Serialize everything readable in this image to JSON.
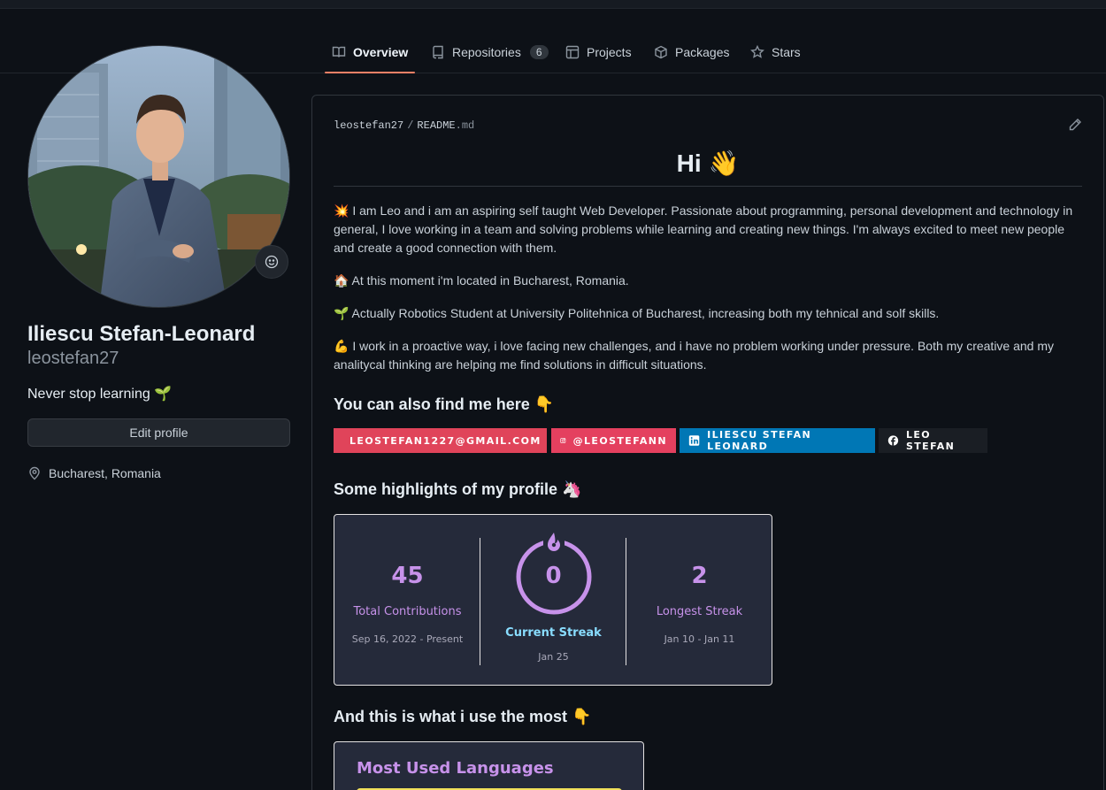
{
  "tabs": [
    {
      "label": "Overview",
      "icon": "book-icon"
    },
    {
      "label": "Repositories",
      "count": "6",
      "icon": "repo-icon"
    },
    {
      "label": "Projects",
      "icon": "table-icon"
    },
    {
      "label": "Packages",
      "icon": "package-icon"
    },
    {
      "label": "Stars",
      "icon": "star-icon"
    }
  ],
  "profile": {
    "fullname": "Iliescu Stefan-Leonard",
    "login": "leostefan27",
    "bio": "Never stop learning 🌱",
    "edit_label": "Edit profile",
    "location": "Bucharest, Romania"
  },
  "readme": {
    "owner": "leostefan27",
    "sep": "/",
    "file": "README",
    "ext": ".md",
    "heading": "Hi 👋",
    "paragraphs": [
      "💥 I am Leo and i am an aspiring self taught Web Developer. Passionate about programming, personal development and technology in general, I love working in a team and solving problems while learning and creating new things. I'm always excited to meet new people and create a good connection with them.",
      "🏠 At this moment i'm located in Bucharest, Romania.",
      "🌱 Actually Robotics Student at University Politehnica of Bucharest, increasing both my tehnical and solf skills.",
      "💪 I work in a proactive way, i love facing new challenges, and i have no problem working under pressure. Both my creative and my analitycal thinking are helping me find solutions in difficult situations."
    ],
    "find_me_heading": "You can also find me here 👇",
    "badges": [
      {
        "label": "LEOSTEFAN1227@GMAIL.COM",
        "color": "#d14836",
        "icon": "gmail-icon"
      },
      {
        "label": "@LEOSTEFANN",
        "color": "#e4405f",
        "icon": "instagram-icon"
      },
      {
        "label": "ILIESCU STEFAN LEONARD",
        "color": "#0077b5",
        "icon": "linkedin-icon"
      },
      {
        "label": "LEO STEFAN",
        "color": "#1a1e24",
        "icon": "facebook-icon"
      }
    ],
    "highlights_heading": "Some highlights of my profile 🦄",
    "streak": {
      "total": {
        "value": "45",
        "label": "Total Contributions",
        "range": "Sep 16, 2022 - Present"
      },
      "current": {
        "value": "0",
        "label": "Current Streak",
        "range": "Jan 25"
      },
      "longest": {
        "value": "2",
        "label": "Longest Streak",
        "range": "Jan 10 - Jan 11"
      }
    },
    "most_used_heading": "And this is what i use the most 👇",
    "languages_title": "Most Used Languages"
  },
  "colors": {
    "background": "#0d1117",
    "accent_underline": "#f78166",
    "streak_purple": "#c792ea",
    "current_streak_blue": "#89ddff"
  }
}
